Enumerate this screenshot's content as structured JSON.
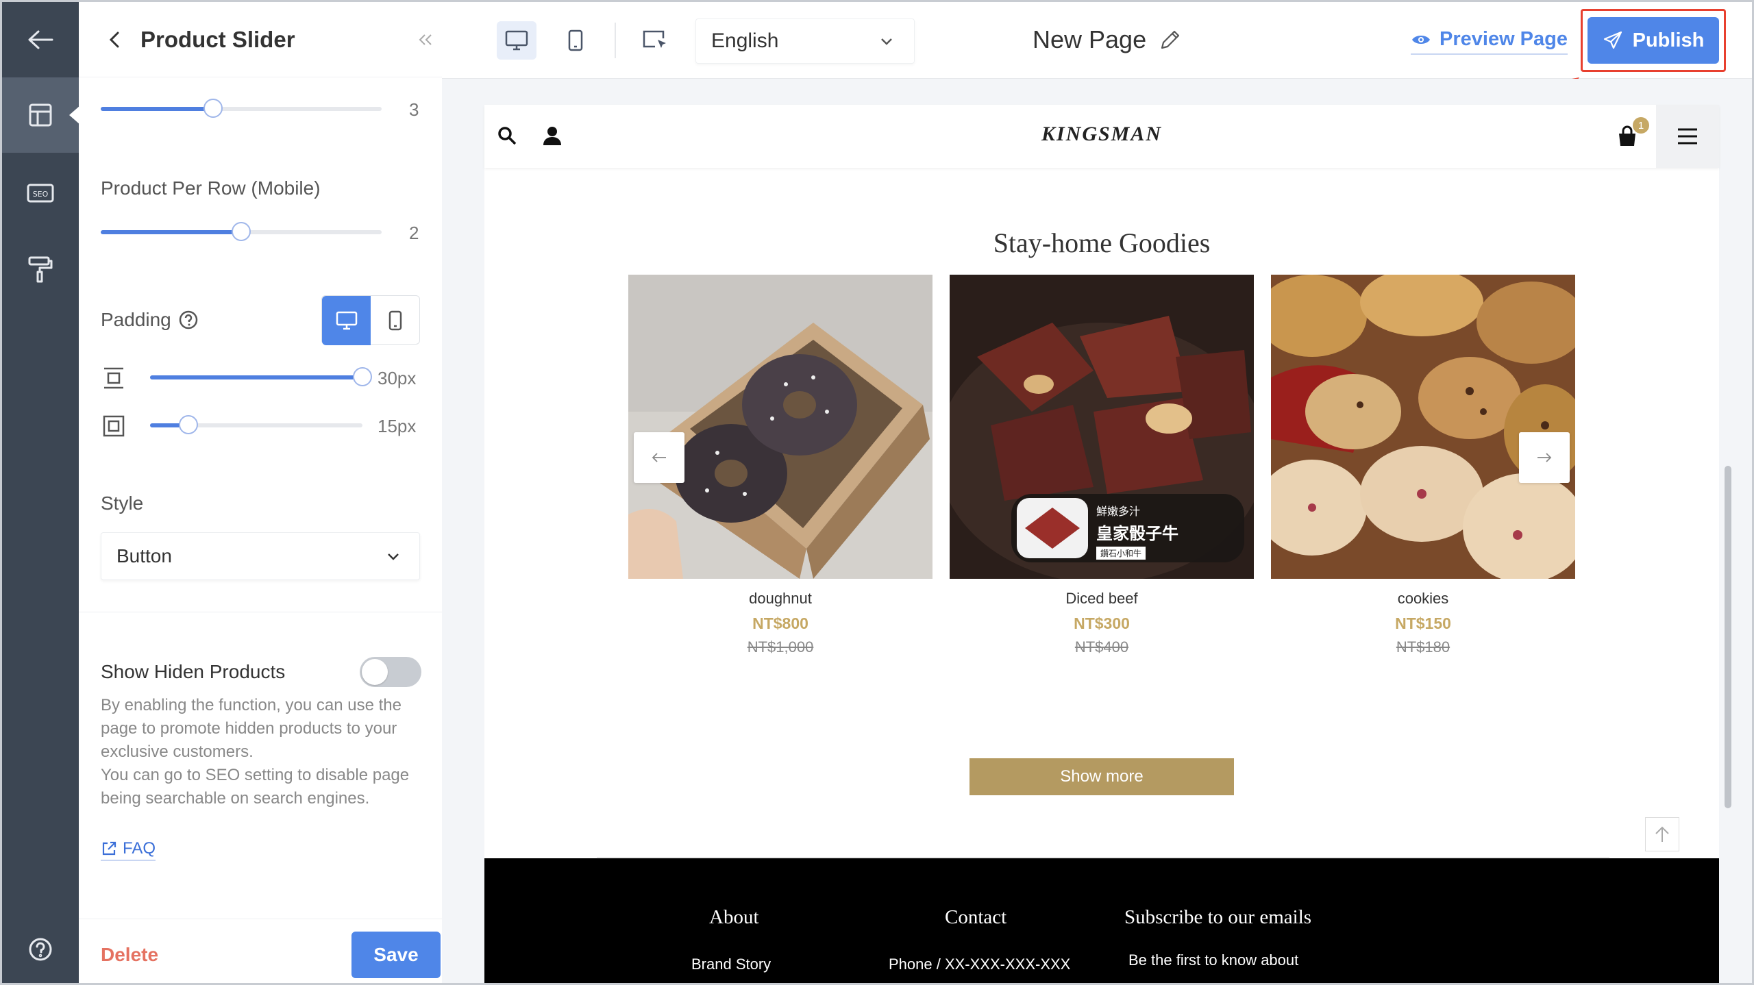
{
  "panel": {
    "title": "Product Slider",
    "slider_top_value": "3",
    "per_row_mobile": {
      "label": "Product Per Row (Mobile)",
      "value": "2",
      "level": 0.5
    },
    "slider_top_level": 0.4,
    "padding": {
      "label": "Padding",
      "vertical": {
        "value": "30px",
        "level": 1.0
      },
      "horizontal": {
        "value": "15px",
        "level": 0.18
      }
    },
    "style": {
      "label": "Style",
      "selected": "Button"
    },
    "hidden_products": {
      "label": "Show Hiden Products",
      "enabled": false,
      "description": "By enabling the function, you can use the page to promote hidden products to your exclusive customers.\nYou can go to SEO setting to disable page being searchable on search engines.",
      "faq_label": "FAQ"
    },
    "delete_label": "Delete",
    "save_label": "Save"
  },
  "toolbar": {
    "language": "English",
    "page_name": "New Page",
    "preview_label": "Preview Page",
    "publish_label": "Publish"
  },
  "site": {
    "brand": "KINGSMAN",
    "cart_count": "1",
    "section_title": "Stay-home Goodies",
    "products": [
      {
        "name": "doughnut",
        "price": "NT$800",
        "original_price": "NT$1,000"
      },
      {
        "name": "Diced beef",
        "price": "NT$300",
        "original_price": "NT$400"
      },
      {
        "name": "cookies",
        "price": "NT$150",
        "original_price": "NT$180"
      }
    ],
    "beef_overlay": {
      "line1": "鮮嫩多汁",
      "line2": "皇家骰子牛",
      "line3": "鑽石小和牛"
    },
    "show_more": "Show more",
    "footer": {
      "about": "About",
      "contact": "Contact",
      "subscribe": "Subscribe to our emails",
      "brand_story": "Brand Story",
      "phone": "Phone / XX-XXX-XXX-XXX",
      "subscribe_text": "Be the first to know about"
    }
  },
  "colors": {
    "accent": "#4f86e8",
    "rail": "#3c4653",
    "gold": "#c6a864",
    "delete": "#e57261",
    "highlight": "#e8402f"
  },
  "icons": [
    "back-arrow-icon",
    "layout-icon",
    "seo-icon",
    "paint-roller-icon",
    "help-icon",
    "chevron-left-icon",
    "collapse-icon",
    "desktop-icon",
    "mobile-icon",
    "cursor-select-icon",
    "chevron-down-icon",
    "pencil-icon",
    "eye-icon",
    "send-icon",
    "search-icon",
    "user-icon",
    "cart-icon",
    "menu-icon",
    "arrow-up-icon",
    "external-link-icon"
  ]
}
